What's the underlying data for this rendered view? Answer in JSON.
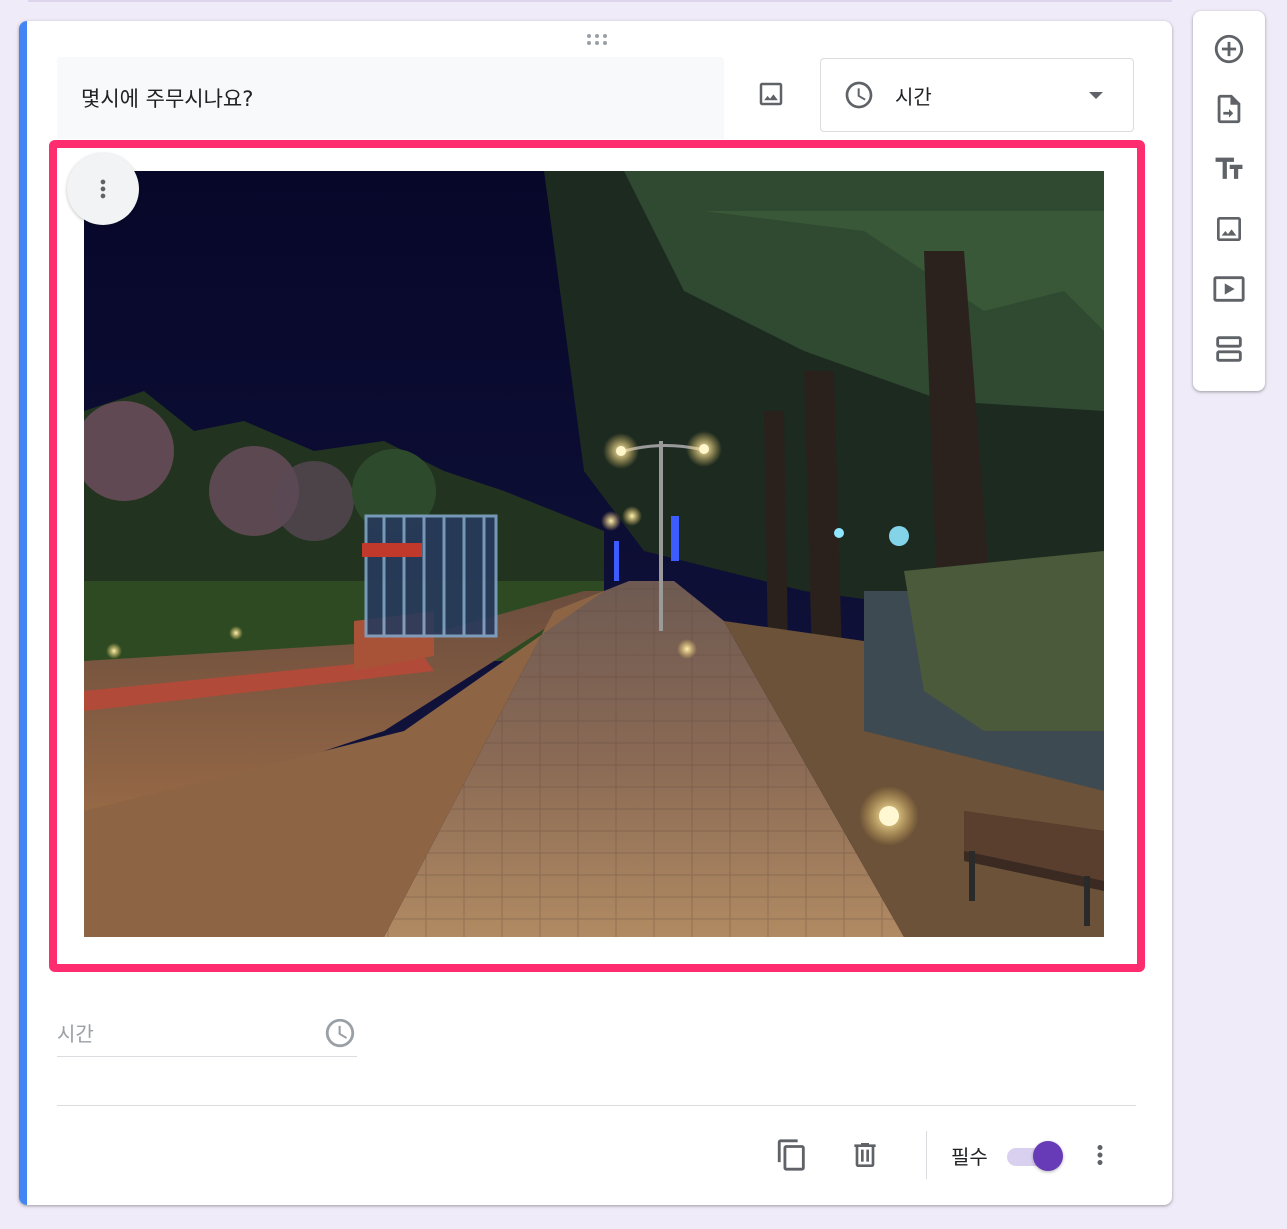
{
  "question": {
    "title": "몇시에 주무시나요?",
    "type_label": "시간"
  },
  "answer": {
    "placeholder": "시간"
  },
  "footer": {
    "required_label": "필수",
    "required_on": true
  },
  "colors": {
    "accent": "#4285f4",
    "highlight": "#ff2d6f",
    "toggle": "#673ab7",
    "background": "#f0ebf8"
  },
  "side_toolbar": [
    "add-question-icon",
    "import-questions-icon",
    "add-title-icon",
    "add-image-icon",
    "add-video-icon",
    "add-section-icon"
  ]
}
